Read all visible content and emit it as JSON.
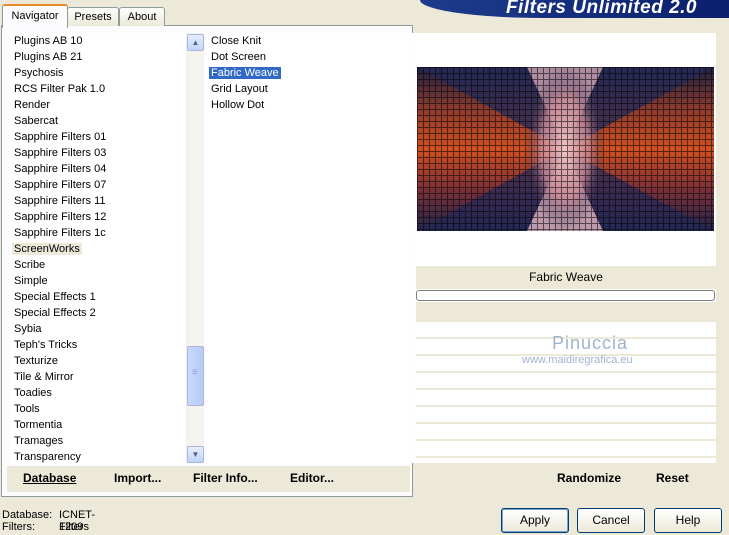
{
  "tabs": [
    {
      "label": "Navigator",
      "active": true
    },
    {
      "label": "Presets",
      "active": false
    },
    {
      "label": "About",
      "active": false
    }
  ],
  "banner_title": "Filters Unlimited 2.0",
  "categories": [
    "Plugins AB 10",
    "Plugins AB 21",
    "Psychosis",
    "RCS Filter Pak 1.0",
    "Render",
    "Sabercat",
    "Sapphire Filters 01",
    "Sapphire Filters 03",
    "Sapphire Filters 04",
    "Sapphire Filters 07",
    "Sapphire Filters 11",
    "Sapphire Filters 12",
    "Sapphire Filters 1c",
    "ScreenWorks",
    "Scribe",
    "Simple",
    "Special Effects 1",
    "Special Effects 2",
    "Sybia",
    "Teph's Tricks",
    "Texturize",
    "Tile & Mirror",
    "Toadies",
    "Tools",
    "Tormentia",
    "Tramages",
    "Transparency"
  ],
  "selected_category": "ScreenWorks",
  "filters": [
    "Close Knit",
    "Dot Screen",
    "Fabric Weave",
    "Grid Layout",
    "Hollow Dot"
  ],
  "selected_filter": "Fabric Weave",
  "preview": {
    "filter_name": "Fabric Weave"
  },
  "watermark": {
    "name": "Pinuccia",
    "url": "www.maidiregrafica.eu"
  },
  "commands": {
    "database": "Database",
    "import": "Import...",
    "filter_info": "Filter Info...",
    "editor": "Editor...",
    "randomize": "Randomize",
    "reset": "Reset"
  },
  "status": {
    "database_label": "Database:",
    "database_value": "ICNET-Filters",
    "filters_label": "Filters:",
    "filters_value": "1209"
  },
  "buttons": {
    "apply": "Apply",
    "cancel": "Cancel",
    "help": "Help"
  }
}
